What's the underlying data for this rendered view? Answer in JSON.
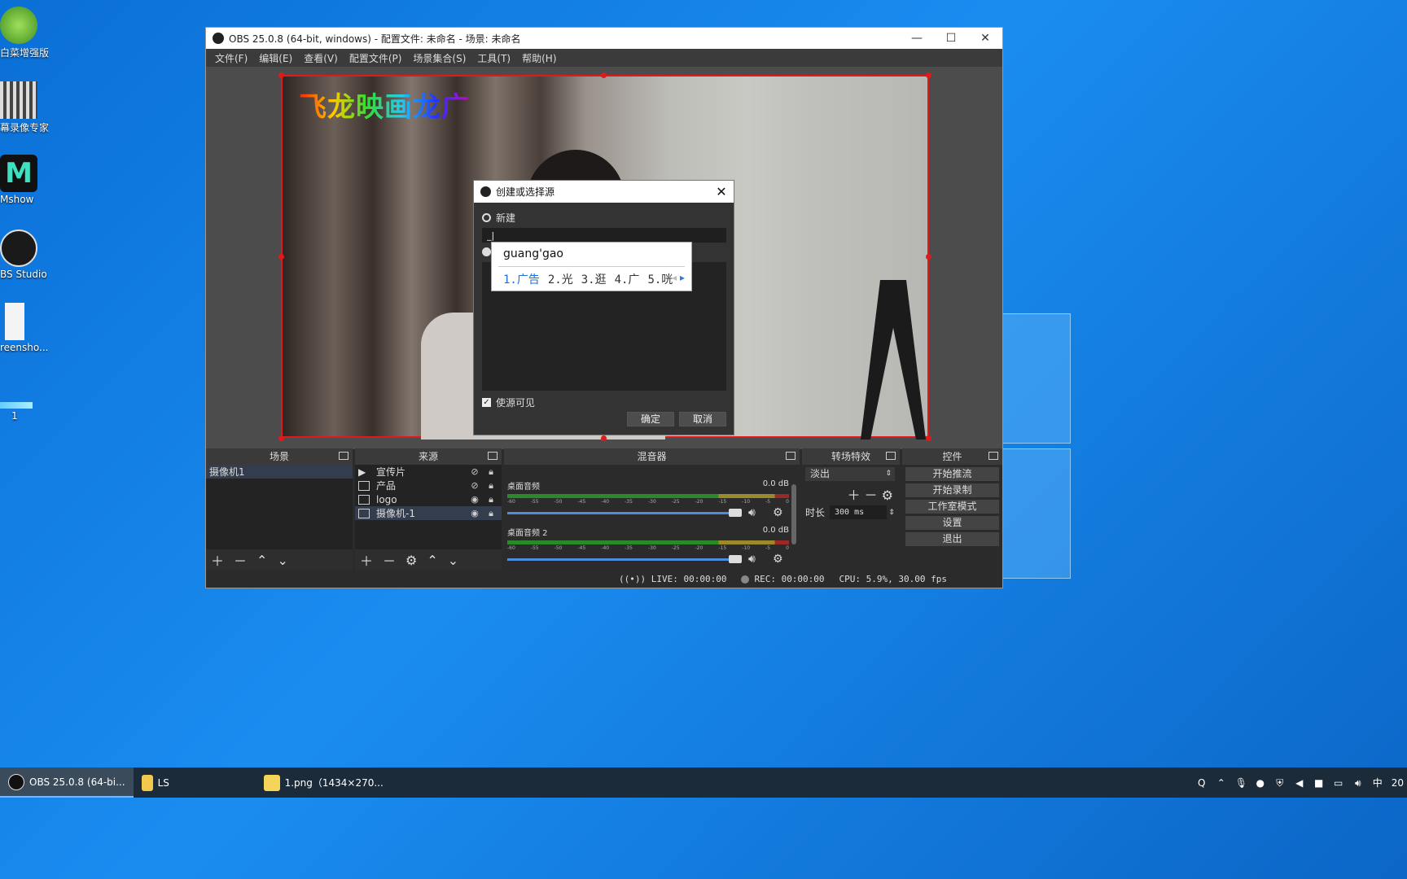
{
  "desktop": {
    "icons": [
      {
        "label": "白菜增强版",
        "icon": "cabbage-icon"
      },
      {
        "label": "幕录像专家",
        "icon": "recorder-icon"
      },
      {
        "label": "Mshow",
        "icon": "mshow-icon"
      },
      {
        "label": "BS Studio",
        "icon": "obs-icon"
      },
      {
        "label": "reensho...",
        "icon": "file-icon"
      },
      {
        "label": "1",
        "icon": "image-icon"
      }
    ]
  },
  "window": {
    "title": "OBS 25.0.8 (64-bit, windows) - 配置文件: 未命名 - 场景: 未命名",
    "controls": {
      "minimize": "—",
      "maximize": "☐",
      "close": "✕"
    }
  },
  "menu": [
    "文件(F)",
    "编辑(E)",
    "查看(V)",
    "配置文件(P)",
    "场景集合(S)",
    "工具(T)",
    "帮助(H)"
  ],
  "preview": {
    "overlay_text": "飞龙映画龙广"
  },
  "dialog": {
    "title": "创建或选择源",
    "close": "✕",
    "new_label": "新建",
    "name_value": "_|",
    "visible_label": "使源可见",
    "visible_checked": true,
    "ok": "确定",
    "cancel": "取消"
  },
  "ime": {
    "composition": "guang'gao",
    "candidates": [
      "1.广告",
      "2.光",
      "3.逛",
      "4.广",
      "5.咣"
    ]
  },
  "scenes": {
    "header": "场景",
    "items": [
      "摄像机1"
    ]
  },
  "sources": {
    "header": "来源",
    "items": [
      {
        "name": "宣传片",
        "icon": "play-icon"
      },
      {
        "name": "产品",
        "icon": "image-icon"
      },
      {
        "name": "logo",
        "icon": "image-icon"
      },
      {
        "name": "摄像机-1",
        "icon": "camera-icon"
      }
    ]
  },
  "mixer": {
    "header": "混音器",
    "channels": [
      {
        "name": "桌面音频",
        "db": "0.0 dB"
      },
      {
        "name": "桌面音频 2",
        "db": "0.0 dB"
      }
    ],
    "ticks": [
      "-60",
      "-55",
      "-50",
      "-45",
      "-40",
      "-35",
      "-30",
      "-25",
      "-20",
      "-15",
      "-10",
      "-5",
      "0"
    ]
  },
  "transitions": {
    "header": "转场特效",
    "selected": "淡出",
    "duration_label": "时长",
    "duration_value": "300 ms"
  },
  "controls": {
    "header": "控件",
    "buttons": [
      "开始推流",
      "开始录制",
      "工作室模式",
      "设置",
      "退出"
    ]
  },
  "status": {
    "live": "LIVE: 00:00:00",
    "rec": "REC: 00:00:00",
    "cpu": "CPU: 5.9%, 30.00 fps"
  },
  "taskbar": {
    "tasks": [
      {
        "label": "OBS 25.0.8 (64-bi...",
        "active": true
      },
      {
        "label": "LS",
        "active": false
      },
      {
        "label": "1.png（1434×270...",
        "active": false
      }
    ],
    "clock": "20"
  }
}
